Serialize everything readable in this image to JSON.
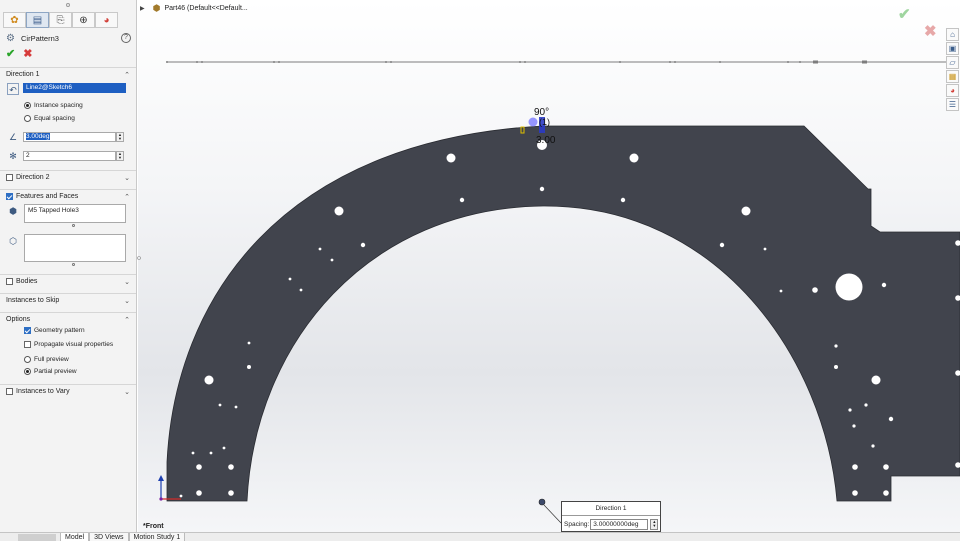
{
  "panel": {
    "tabs": [
      "feature-manager-icon",
      "property-manager-icon",
      "configuration-manager-icon",
      "dimxpert-icon",
      "display-manager-icon"
    ],
    "title": "CirPattern3",
    "help": "?",
    "ok": "✔",
    "cancel": "✖",
    "direction1": {
      "header": "Direction 1",
      "axis_value": "Line2@Sketch6",
      "instance_spacing": "Instance spacing",
      "equal_spacing": "Equal spacing",
      "angle_value": "3.00deg",
      "count_value": "2"
    },
    "direction2": {
      "header": "Direction 2"
    },
    "features_faces": {
      "header": "Features and Faces",
      "feature_item": "M5 Tapped Hole3"
    },
    "bodies": {
      "header": "Bodies"
    },
    "instances_to_skip": {
      "header": "Instances to Skip"
    },
    "options": {
      "header": "Options",
      "geometry_pattern": "Geometry pattern",
      "propagate": "Propagate visual properties",
      "full_preview": "Full preview",
      "partial_preview": "Partial preview"
    },
    "instances_to_vary": {
      "header": "Instances to Vary"
    }
  },
  "graphics": {
    "tree_item": "Part46  (Default<<Default...",
    "dim_angle": "90°",
    "dim_count": "(1)",
    "dim_spacing": "3.00",
    "callout": {
      "title": "Direction 1",
      "label": "Spacing:",
      "value": "3.00000000deg"
    },
    "view_name": "*Front"
  },
  "task_pane": [
    "home-icon",
    "design-library-icon",
    "file-explorer-icon",
    "view-palette-icon",
    "appearances-icon",
    "custom-properties-icon"
  ],
  "bottom_tabs": [
    "Model",
    "3D Views",
    "Motion Study 1"
  ],
  "colors": {
    "part_fill": "#41444d",
    "selection_blue": "#1e5fc2"
  }
}
